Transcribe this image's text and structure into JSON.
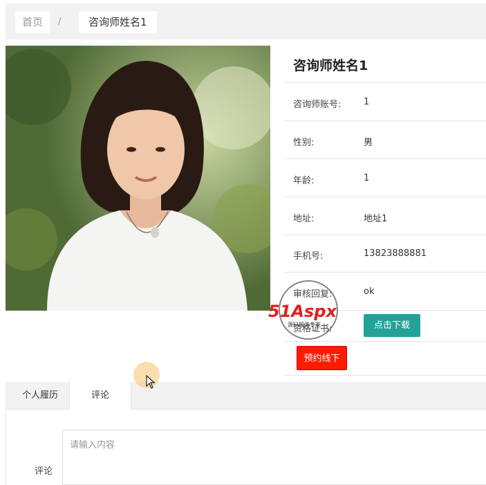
{
  "breadcrumb": {
    "home": "首页",
    "separator": "/",
    "current": "咨询师姓名1"
  },
  "profile": {
    "title": "咨询师姓名1",
    "fields": [
      {
        "label": "咨询师账号:",
        "value": "1"
      },
      {
        "label": "性别:",
        "value": "男"
      },
      {
        "label": "年龄:",
        "value": "1"
      },
      {
        "label": "地址:",
        "value": "地址1"
      },
      {
        "label": "手机号:",
        "value": "13823888881"
      },
      {
        "label": "审核回复:",
        "value": "ok"
      },
      {
        "label": "资格证书:",
        "value": ""
      }
    ],
    "download_label": "点击下载",
    "reserve_label": "预约线下"
  },
  "watermark": {
    "brand": "51Aspx",
    "tagline": "源码服务专家"
  },
  "tabs": [
    {
      "label": "个人履历"
    },
    {
      "label": "评论"
    }
  ],
  "comment": {
    "label": "评论",
    "placeholder": "请输入内容"
  },
  "colors": {
    "download_button": "#24a198",
    "reserve_button": "#ff1c00",
    "topbar": "#f2f2f2"
  }
}
